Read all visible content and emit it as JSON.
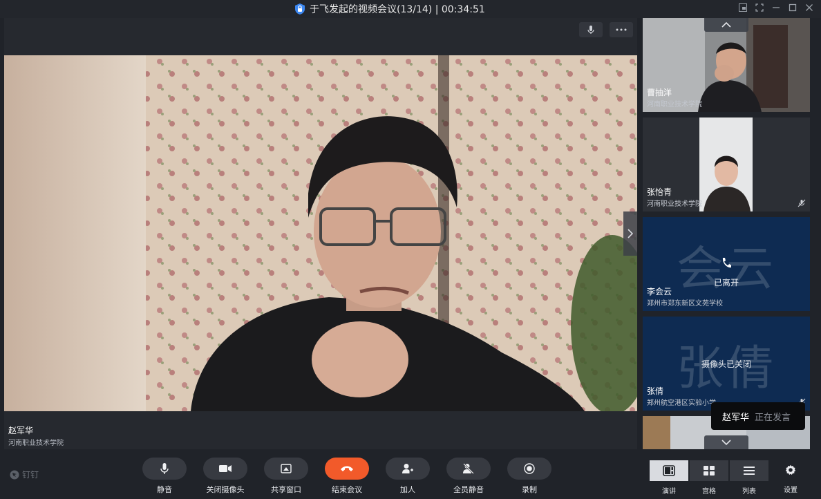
{
  "window": {
    "title": "于飞发起的视频会议(13/14) | 00:34:51"
  },
  "main_video": {
    "name": "赵军华",
    "org": "河南职业技术学院"
  },
  "participants": [
    {
      "name": "曹抽洋",
      "org": "河南职业技术学院",
      "kind": "video"
    },
    {
      "name": "张怡青",
      "org": "河南职业技术学院",
      "kind": "video",
      "muted": true
    },
    {
      "name": "李会云",
      "org": "郑州市郑东新区文苑学校",
      "kind": "avatar",
      "avatar_text": "会云",
      "status": "已离开"
    },
    {
      "name": "张倩",
      "org": "郑州航空港区实验小学",
      "kind": "avatar",
      "avatar_text": "张倩",
      "status": "摄像头已关闭",
      "muted": true
    }
  ],
  "speaking_toast": {
    "name": "赵军华",
    "status": "正在发言"
  },
  "toolbar": {
    "brand": "钉钉",
    "mute": "静音",
    "camera_off": "关闭摄像头",
    "share": "共享窗口",
    "end": "结束会议",
    "invite": "加人",
    "mute_all": "全员静音",
    "record": "录制",
    "view_speaker": "演讲",
    "view_grid": "宫格",
    "view_list": "列表",
    "settings": "设置"
  },
  "colors": {
    "end_button": "#f25a2a",
    "avatar_tile": "#0e2b52",
    "background": "#202329"
  }
}
